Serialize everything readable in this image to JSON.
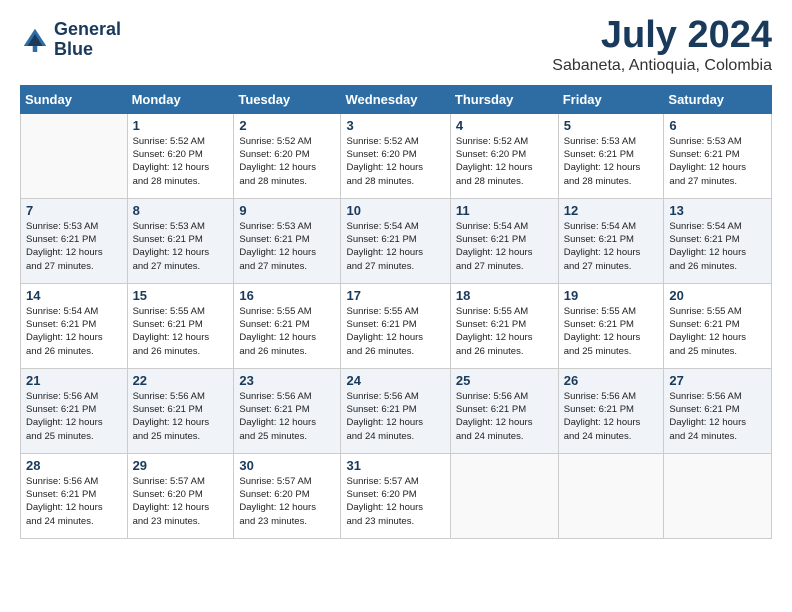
{
  "header": {
    "logo_line1": "General",
    "logo_line2": "Blue",
    "title": "July 2024",
    "subtitle": "Sabaneta, Antioquia, Colombia"
  },
  "days_of_week": [
    "Sunday",
    "Monday",
    "Tuesday",
    "Wednesday",
    "Thursday",
    "Friday",
    "Saturday"
  ],
  "weeks": [
    [
      {
        "day": "",
        "info": ""
      },
      {
        "day": "1",
        "info": "Sunrise: 5:52 AM\nSunset: 6:20 PM\nDaylight: 12 hours\nand 28 minutes."
      },
      {
        "day": "2",
        "info": "Sunrise: 5:52 AM\nSunset: 6:20 PM\nDaylight: 12 hours\nand 28 minutes."
      },
      {
        "day": "3",
        "info": "Sunrise: 5:52 AM\nSunset: 6:20 PM\nDaylight: 12 hours\nand 28 minutes."
      },
      {
        "day": "4",
        "info": "Sunrise: 5:52 AM\nSunset: 6:20 PM\nDaylight: 12 hours\nand 28 minutes."
      },
      {
        "day": "5",
        "info": "Sunrise: 5:53 AM\nSunset: 6:21 PM\nDaylight: 12 hours\nand 28 minutes."
      },
      {
        "day": "6",
        "info": "Sunrise: 5:53 AM\nSunset: 6:21 PM\nDaylight: 12 hours\nand 27 minutes."
      }
    ],
    [
      {
        "day": "7",
        "info": "Sunrise: 5:53 AM\nSunset: 6:21 PM\nDaylight: 12 hours\nand 27 minutes."
      },
      {
        "day": "8",
        "info": "Sunrise: 5:53 AM\nSunset: 6:21 PM\nDaylight: 12 hours\nand 27 minutes."
      },
      {
        "day": "9",
        "info": "Sunrise: 5:53 AM\nSunset: 6:21 PM\nDaylight: 12 hours\nand 27 minutes."
      },
      {
        "day": "10",
        "info": "Sunrise: 5:54 AM\nSunset: 6:21 PM\nDaylight: 12 hours\nand 27 minutes."
      },
      {
        "day": "11",
        "info": "Sunrise: 5:54 AM\nSunset: 6:21 PM\nDaylight: 12 hours\nand 27 minutes."
      },
      {
        "day": "12",
        "info": "Sunrise: 5:54 AM\nSunset: 6:21 PM\nDaylight: 12 hours\nand 27 minutes."
      },
      {
        "day": "13",
        "info": "Sunrise: 5:54 AM\nSunset: 6:21 PM\nDaylight: 12 hours\nand 26 minutes."
      }
    ],
    [
      {
        "day": "14",
        "info": "Sunrise: 5:54 AM\nSunset: 6:21 PM\nDaylight: 12 hours\nand 26 minutes."
      },
      {
        "day": "15",
        "info": "Sunrise: 5:55 AM\nSunset: 6:21 PM\nDaylight: 12 hours\nand 26 minutes."
      },
      {
        "day": "16",
        "info": "Sunrise: 5:55 AM\nSunset: 6:21 PM\nDaylight: 12 hours\nand 26 minutes."
      },
      {
        "day": "17",
        "info": "Sunrise: 5:55 AM\nSunset: 6:21 PM\nDaylight: 12 hours\nand 26 minutes."
      },
      {
        "day": "18",
        "info": "Sunrise: 5:55 AM\nSunset: 6:21 PM\nDaylight: 12 hours\nand 26 minutes."
      },
      {
        "day": "19",
        "info": "Sunrise: 5:55 AM\nSunset: 6:21 PM\nDaylight: 12 hours\nand 25 minutes."
      },
      {
        "day": "20",
        "info": "Sunrise: 5:55 AM\nSunset: 6:21 PM\nDaylight: 12 hours\nand 25 minutes."
      }
    ],
    [
      {
        "day": "21",
        "info": "Sunrise: 5:56 AM\nSunset: 6:21 PM\nDaylight: 12 hours\nand 25 minutes."
      },
      {
        "day": "22",
        "info": "Sunrise: 5:56 AM\nSunset: 6:21 PM\nDaylight: 12 hours\nand 25 minutes."
      },
      {
        "day": "23",
        "info": "Sunrise: 5:56 AM\nSunset: 6:21 PM\nDaylight: 12 hours\nand 25 minutes."
      },
      {
        "day": "24",
        "info": "Sunrise: 5:56 AM\nSunset: 6:21 PM\nDaylight: 12 hours\nand 24 minutes."
      },
      {
        "day": "25",
        "info": "Sunrise: 5:56 AM\nSunset: 6:21 PM\nDaylight: 12 hours\nand 24 minutes."
      },
      {
        "day": "26",
        "info": "Sunrise: 5:56 AM\nSunset: 6:21 PM\nDaylight: 12 hours\nand 24 minutes."
      },
      {
        "day": "27",
        "info": "Sunrise: 5:56 AM\nSunset: 6:21 PM\nDaylight: 12 hours\nand 24 minutes."
      }
    ],
    [
      {
        "day": "28",
        "info": "Sunrise: 5:56 AM\nSunset: 6:21 PM\nDaylight: 12 hours\nand 24 minutes."
      },
      {
        "day": "29",
        "info": "Sunrise: 5:57 AM\nSunset: 6:20 PM\nDaylight: 12 hours\nand 23 minutes."
      },
      {
        "day": "30",
        "info": "Sunrise: 5:57 AM\nSunset: 6:20 PM\nDaylight: 12 hours\nand 23 minutes."
      },
      {
        "day": "31",
        "info": "Sunrise: 5:57 AM\nSunset: 6:20 PM\nDaylight: 12 hours\nand 23 minutes."
      },
      {
        "day": "",
        "info": ""
      },
      {
        "day": "",
        "info": ""
      },
      {
        "day": "",
        "info": ""
      }
    ]
  ]
}
